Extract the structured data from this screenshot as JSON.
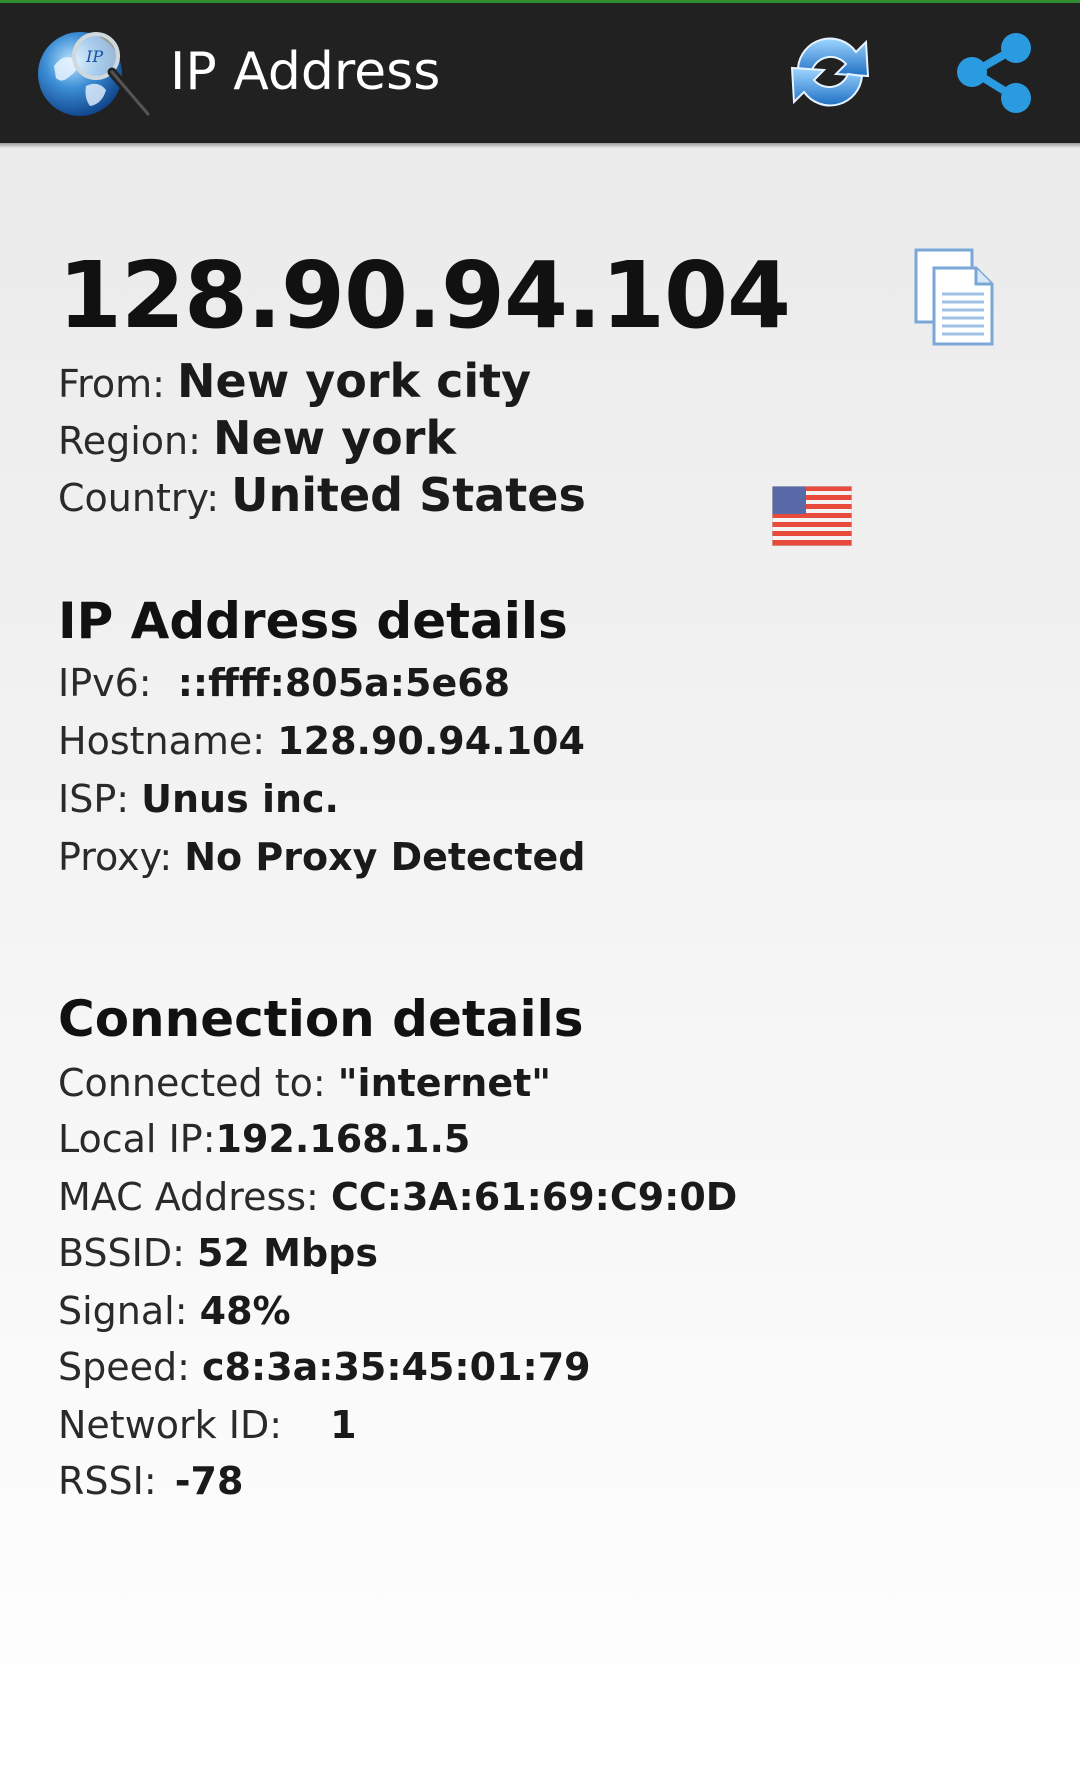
{
  "app": {
    "title": "IP Address",
    "icon": "globe-magnifier-icon",
    "actions": [
      {
        "name": "refresh",
        "icon": "refresh-icon"
      },
      {
        "name": "share",
        "icon": "share-icon"
      }
    ]
  },
  "ip": {
    "address": "128.90.94.104",
    "from_label": "From:",
    "from_value": "New york city",
    "region_label": "Region:",
    "region_value": "New york",
    "country_label": "Country:",
    "country_value": "United States",
    "flag_icon": "us-flag-icon",
    "copy_icon": "copy-icon"
  },
  "ip_details": {
    "heading": "IP Address details",
    "ipv6_label": "IPv6:",
    "ipv6_value": "::ffff:805a:5e68",
    "hostname_label": "Hostname:",
    "hostname_value": "128.90.94.104",
    "isp_label": "ISP:",
    "isp_value": "Unus inc.",
    "proxy_label": "Proxy:",
    "proxy_value": "No Proxy Detected"
  },
  "connection": {
    "heading": "Connection details",
    "connected_label": "Connected to:",
    "connected_value": "\"internet\"",
    "local_ip_label": "Local IP:",
    "local_ip_value": "192.168.1.5",
    "mac_label": "MAC Address:",
    "mac_value": "CC:3A:61:69:C9:0D",
    "bssid_label": "BSSID:",
    "bssid_value": "52 Mbps",
    "signal_label": "Signal:",
    "signal_value": "48%",
    "speed_label": "Speed:",
    "speed_value": "c8:3a:35:45:01:79",
    "network_id_label": "Network ID:",
    "network_id_value": "1",
    "rssi_label": "RSSI:",
    "rssi_value": "-78"
  },
  "colors": {
    "action_bar": "#212121",
    "accent_blue": "#2a9be0",
    "top_line": "#2f8f2f"
  }
}
